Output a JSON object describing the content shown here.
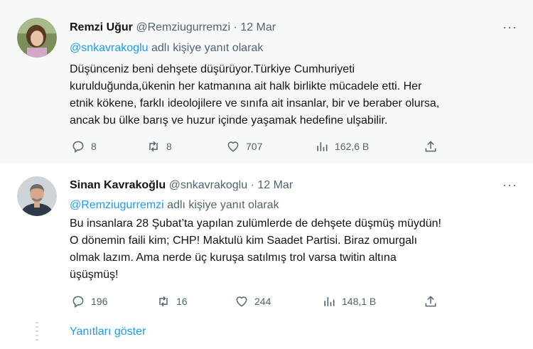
{
  "tweets": [
    {
      "name": "Remzi Uğur",
      "handle": "@Remziugurremzi",
      "separator": "·",
      "date": "12 Mar",
      "reply_mention": "@snkavrakoglu",
      "reply_suffix": "adlı kişiye yanıt olarak",
      "body_lines": [
        "Düşünceniz beni dehşete düşürüyor.Türkiye Cumhuriyeti",
        "kurulduğunda,ükenin her katmanına ait halk birlikte mücadele etti. Her",
        "etnik kökene, farklı ideolojilere ve sınıfa ait insanlar, bir ve beraber olursa,",
        "ancak bu ülke barış ve huzur içinde yaşamak hedefine ulşabilir."
      ],
      "replies": "8",
      "retweets": "8",
      "likes": "707",
      "views": "162,6 B"
    },
    {
      "name": "Sinan Kavrakoğlu",
      "handle": "@snkavrakoglu",
      "separator": "·",
      "date": "12 Mar",
      "reply_mention": "@Remziugurremzi",
      "reply_suffix": "adlı kişiye yanıt olarak",
      "body_lines": [
        "Bu insanlara 28 Şubat’ta yapılan zulümlerde de dehşete düşmüş müydün!",
        "O dönemin faili kim; CHP! Maktulü kim Saadet Partisi. Biraz omurgalı",
        "olmak lazım. Ama nerde üç kuruşa satılmış trol varsa twitin altına",
        "üşüşmüş!"
      ],
      "replies": "196",
      "retweets": "16",
      "likes": "244",
      "views": "148,1 B"
    }
  ],
  "more_icon_glyph": "···",
  "show_replies_label": "Yanıtları göster",
  "icons": {
    "reply": "reply-icon",
    "retweet": "retweet-icon",
    "like": "heart-icon",
    "views": "views-icon",
    "share": "share-icon"
  },
  "colors": {
    "accent": "#1d9bf0",
    "secondary_text": "#536471",
    "primary_text": "#0f1419",
    "highlight_bg": "#f7f9f9"
  }
}
